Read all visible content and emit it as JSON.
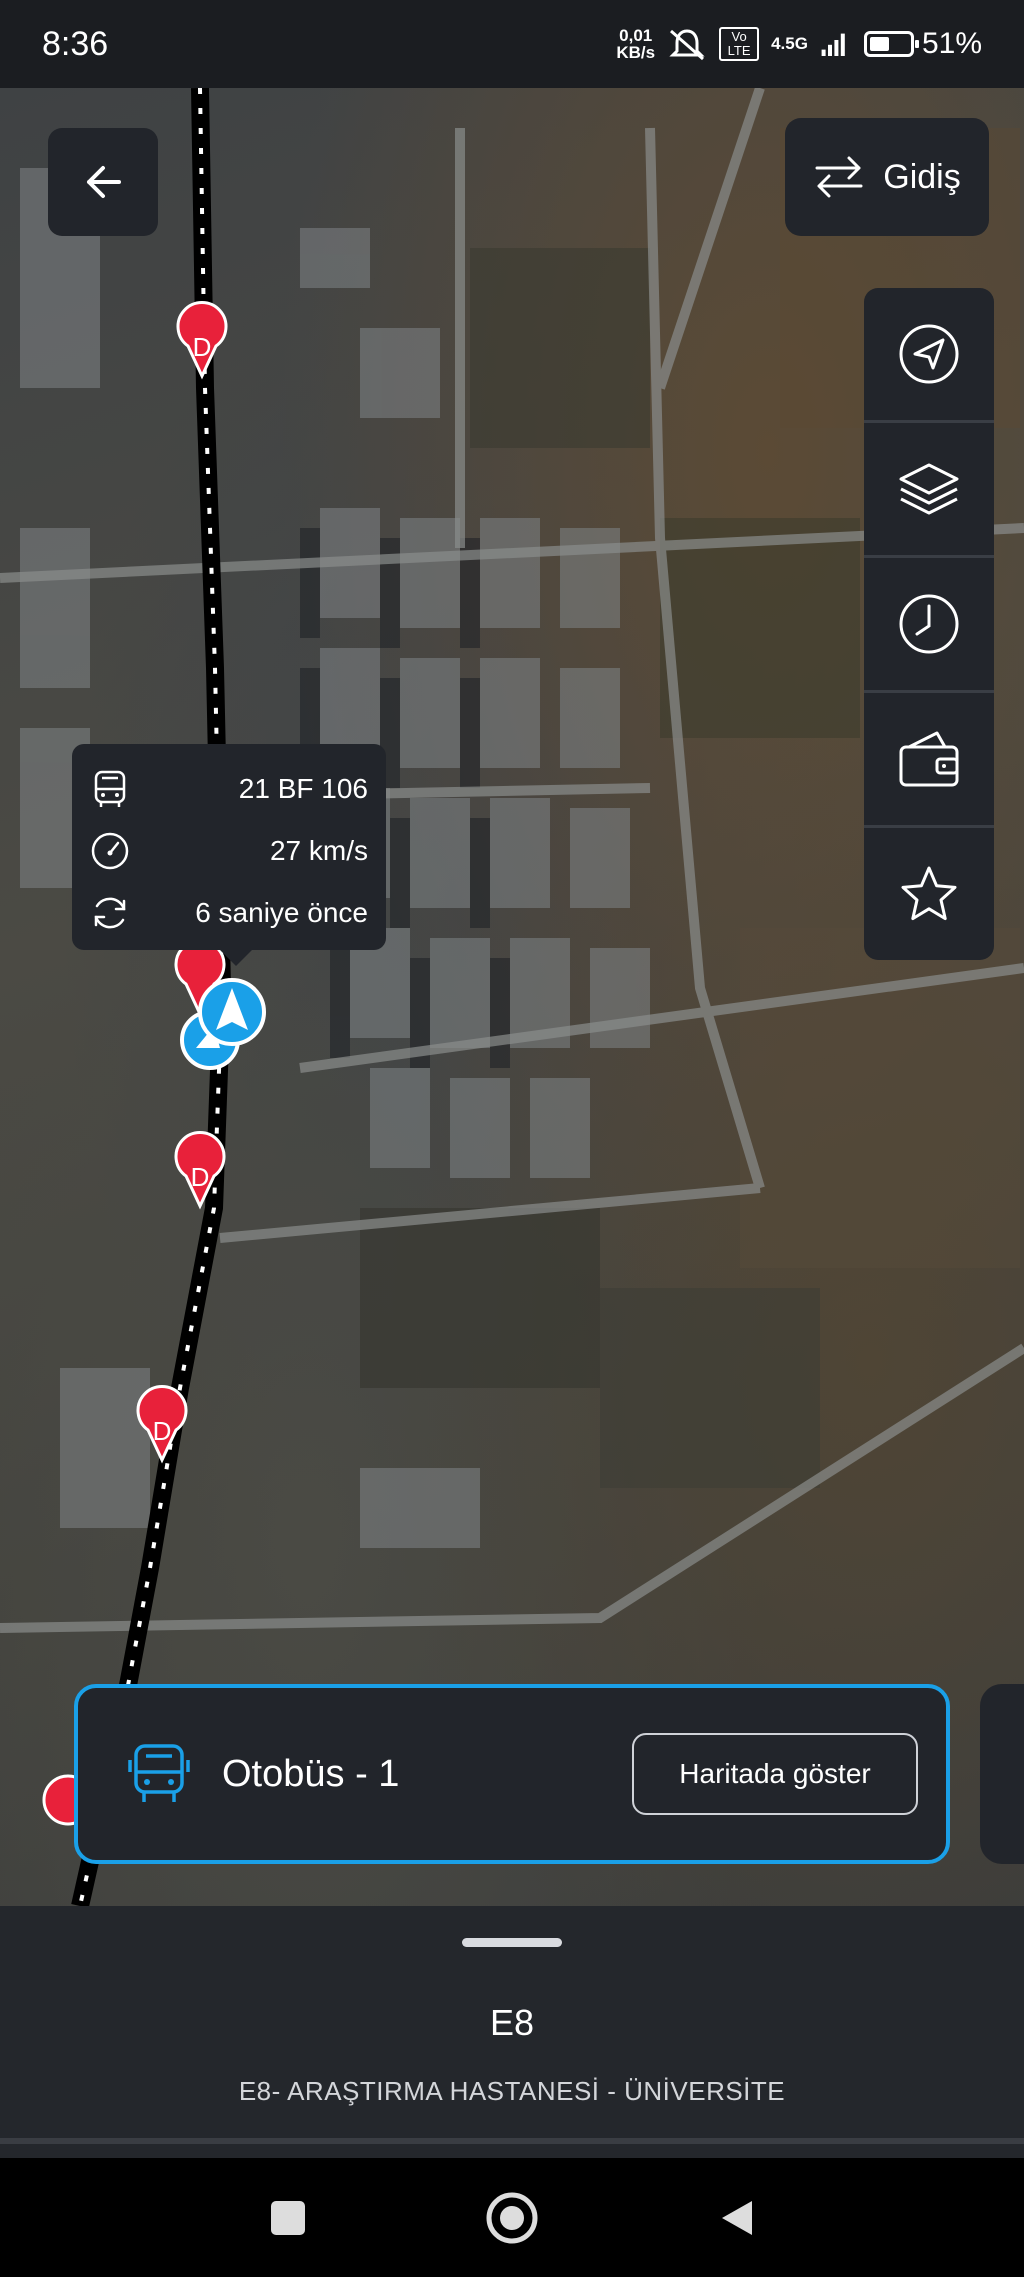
{
  "status_bar": {
    "time": "8:36",
    "net_speed_value": "0,01",
    "net_speed_unit": "KB/s",
    "network": "4.5G",
    "volte": "Vo LTE",
    "battery_percent": "51%",
    "battery_level": 0.51
  },
  "map": {
    "direction_label": "Gidiş",
    "stop_marker_letter": "D"
  },
  "vehicle": {
    "plate": "21 BF 106",
    "speed": "27 km/s",
    "updated": "6 saniye önce"
  },
  "bus_card": {
    "title": "Otobüs - 1",
    "button_label": "Haritada göster"
  },
  "route": {
    "code": "E8",
    "name": "E8- ARAŞTIRMA HASTANESİ - ÜNİVERSİTE"
  },
  "colors": {
    "accent": "#1aa0e8",
    "stop_marker": "#e8213a",
    "panel": "#22252b"
  }
}
